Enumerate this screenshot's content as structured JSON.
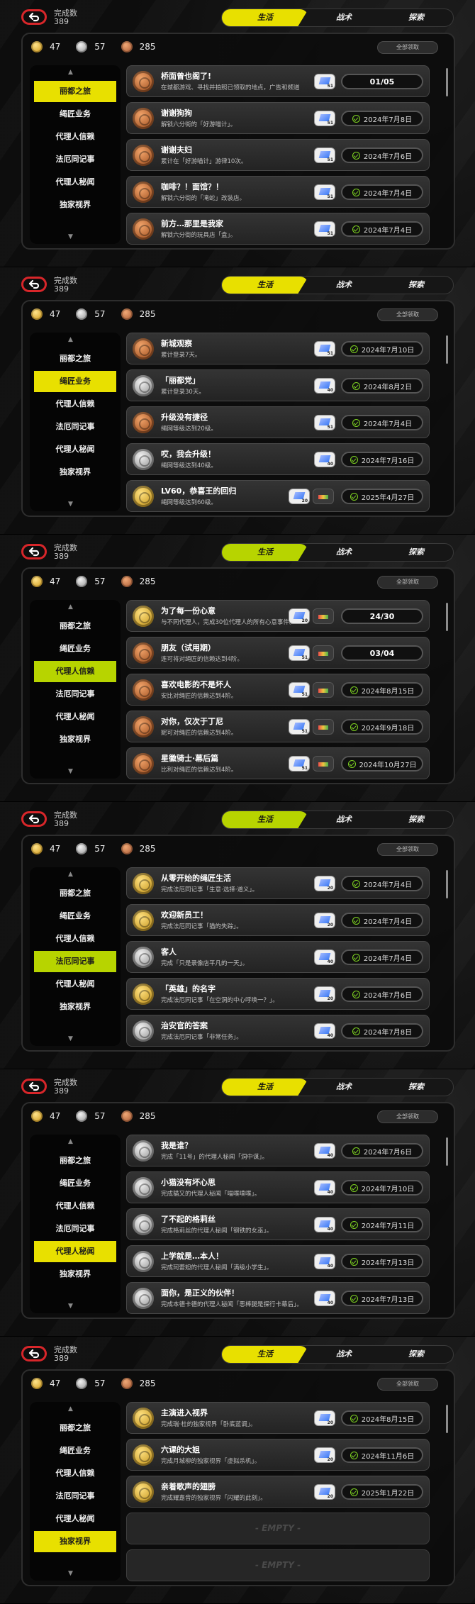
{
  "header": {
    "count_label": "完成数",
    "count_value": "389",
    "tabs": [
      "生活",
      "战术",
      "探索"
    ],
    "claim_all": "全部领取"
  },
  "currency": {
    "gold": "47",
    "silver": "57",
    "bronze": "285"
  },
  "sidebar": [
    "丽都之旅",
    "绳匠业务",
    "代理人信赖",
    "法厄同记事",
    "代理人秘闻",
    "独家视界"
  ],
  "panels": [
    {
      "active_index": 0,
      "items": [
        {
          "title": "桥面曾也阁了!",
          "desc": "在城都游戏、寻找并拍照已领取的地点，广告和频道",
          "medal": "bronze",
          "rewards": [
            {
              "type": "film",
              "n": "51"
            }
          ],
          "status": "01/05",
          "kind": "progress"
        },
        {
          "title": "谢谢狗狗",
          "desc": "解锁六分街的「好游喵计」。",
          "medal": "bronze",
          "rewards": [
            {
              "type": "film",
              "n": "51"
            }
          ],
          "status": "2024年7月8日",
          "kind": "done"
        },
        {
          "title": "谢谢夫妇",
          "desc": "累计在「好游喵计」游律10次。",
          "medal": "bronze",
          "rewards": [
            {
              "type": "film",
              "n": "51"
            }
          ],
          "status": "2024年7月6日",
          "kind": "done"
        },
        {
          "title": "咖啡？！面馆？！",
          "desc": "解锁六分街的「滝蛇」改装店。",
          "medal": "bronze",
          "rewards": [
            {
              "type": "film",
              "n": "51"
            }
          ],
          "status": "2024年7月4日",
          "kind": "done"
        },
        {
          "title": "前方…那里是我家",
          "desc": "解锁六分街的玩具店「盒」。",
          "medal": "bronze",
          "rewards": [
            {
              "type": "film",
              "n": "51"
            }
          ],
          "status": "2024年7月4日",
          "kind": "done"
        }
      ]
    },
    {
      "active_index": 1,
      "items": [
        {
          "title": "新城观察",
          "desc": "累计登录7天。",
          "medal": "bronze",
          "rewards": [
            {
              "type": "film",
              "n": "51"
            }
          ],
          "status": "2024年7月10日",
          "kind": "done"
        },
        {
          "title": "「丽都党」",
          "desc": "累计登录30天。",
          "medal": "silver",
          "rewards": [
            {
              "type": "film",
              "n": "40"
            }
          ],
          "status": "2024年8月2日",
          "kind": "done"
        },
        {
          "title": "升级没有捷径",
          "desc": "绳网等级达到20级。",
          "medal": "bronze",
          "rewards": [
            {
              "type": "film",
              "n": "51"
            }
          ],
          "status": "2024年7月4日",
          "kind": "done"
        },
        {
          "title": "哎，我会升级！",
          "desc": "绳网等级达到40级。",
          "medal": "silver",
          "rewards": [
            {
              "type": "film",
              "n": "40"
            }
          ],
          "status": "2024年7月16日",
          "kind": "done"
        },
        {
          "title": "LV60，恭喜王的回归",
          "desc": "绳网等级达到60级。",
          "medal": "gold",
          "rewards": [
            {
              "type": "film",
              "n": "20"
            },
            {
              "type": "card",
              "n": ""
            }
          ],
          "status": "2025年4月27日",
          "kind": "done"
        }
      ]
    },
    {
      "active_index": 2,
      "items": [
        {
          "title": "为了每一份心意",
          "desc": "与不同代理人，完成30位代理人的所有心意事件。",
          "medal": "gold",
          "rewards": [
            {
              "type": "film",
              "n": "20"
            },
            {
              "type": "card",
              "n": ""
            }
          ],
          "status": "24/30",
          "kind": "progress"
        },
        {
          "title": "朋友（试用期）",
          "desc": "连可将对绳匠的信赖达到4阶。",
          "medal": "bronze",
          "rewards": [
            {
              "type": "film",
              "n": "51"
            },
            {
              "type": "card",
              "n": ""
            }
          ],
          "status": "03/04",
          "kind": "progress"
        },
        {
          "title": "喜欢电影的不是坏人",
          "desc": "安比对绳匠的信赖达到4阶。",
          "medal": "bronze",
          "rewards": [
            {
              "type": "film",
              "n": "51"
            },
            {
              "type": "card",
              "n": ""
            }
          ],
          "status": "2024年8月15日",
          "kind": "done"
        },
        {
          "title": "对你，仅次于丁尼",
          "desc": "妮可对绳匠的信赖达到4阶。",
          "medal": "bronze",
          "rewards": [
            {
              "type": "film",
              "n": "51"
            },
            {
              "type": "card",
              "n": ""
            }
          ],
          "status": "2024年9月18日",
          "kind": "done"
        },
        {
          "title": "星徽骑士·幕后篇",
          "desc": "比利对绳匠的信赖达到4阶。",
          "medal": "bronze",
          "rewards": [
            {
              "type": "film",
              "n": "51"
            },
            {
              "type": "card",
              "n": ""
            }
          ],
          "status": "2024年10月27日",
          "kind": "done"
        }
      ]
    },
    {
      "active_index": 3,
      "items": [
        {
          "title": "从零开始的绳匠生活",
          "desc": "完成法厄同记事「生意·选择·道义」。",
          "medal": "gold",
          "rewards": [
            {
              "type": "film",
              "n": "20"
            }
          ],
          "status": "2024年7月4日",
          "kind": "done"
        },
        {
          "title": "欢迎新员工！",
          "desc": "完成法厄同记事「猫的失踪」。",
          "medal": "gold",
          "rewards": [
            {
              "type": "film",
              "n": "20"
            }
          ],
          "status": "2024年7月4日",
          "kind": "done"
        },
        {
          "title": "客人",
          "desc": "完成「只是录像店平凡的一天」。",
          "medal": "silver",
          "rewards": [
            {
              "type": "film",
              "n": "40"
            }
          ],
          "status": "2024年7月4日",
          "kind": "done"
        },
        {
          "title": "「英雄」的名字",
          "desc": "完成法厄同记事「在空洞的中心呼唤一？」。",
          "medal": "gold",
          "rewards": [
            {
              "type": "film",
              "n": "20"
            }
          ],
          "status": "2024年7月6日",
          "kind": "done"
        },
        {
          "title": "治安官的答案",
          "desc": "完成法厄同记事「非常任务」。",
          "medal": "silver",
          "rewards": [
            {
              "type": "film",
              "n": "40"
            }
          ],
          "status": "2024年7月8日",
          "kind": "done"
        }
      ]
    },
    {
      "active_index": 4,
      "items": [
        {
          "title": "我是谁？",
          "desc": "完成「11号」的代理人秘闻「洞中谋」。",
          "medal": "silver",
          "rewards": [
            {
              "type": "film",
              "n": "40"
            }
          ],
          "status": "2024年7月6日",
          "kind": "done"
        },
        {
          "title": "小猫没有坏心思",
          "desc": "完成猫又的代理人秘闻「喵噗噗噗」。",
          "medal": "silver",
          "rewards": [
            {
              "type": "film",
              "n": "40"
            }
          ],
          "status": "2024年7月10日",
          "kind": "done"
        },
        {
          "title": "了不起的格莉丝",
          "desc": "完成格莉丝的代理人秘闻「钢铁的女巫」。",
          "medal": "silver",
          "rewards": [
            {
              "type": "film",
              "n": "40"
            }
          ],
          "status": "2024年7月11日",
          "kind": "done"
        },
        {
          "title": "上学就是…本人！",
          "desc": "完成珂蕾妲的代理人秘闻「满级小学生」。",
          "medal": "silver",
          "rewards": [
            {
              "type": "film",
              "n": "40"
            }
          ],
          "status": "2024年7月13日",
          "kind": "done"
        },
        {
          "title": "面你，是正义的伙伴！",
          "desc": "完成本德卡德的代理人秘闻「恶棒腿是探行卡幕后」。",
          "medal": "silver",
          "rewards": [
            {
              "type": "film",
              "n": "40"
            }
          ],
          "status": "2024年7月13日",
          "kind": "done"
        }
      ]
    },
    {
      "active_index": 5,
      "items": [
        {
          "title": "主演进入视界",
          "desc": "完成瑞·杜的独家视界「卧底蓝调」。",
          "medal": "gold",
          "rewards": [
            {
              "type": "film",
              "n": "20"
            }
          ],
          "status": "2024年8月15日",
          "kind": "done"
        },
        {
          "title": "六课的大姐",
          "desc": "完成月城柳的独家视界「虚拟杀机」。",
          "medal": "gold",
          "rewards": [
            {
              "type": "film",
              "n": "20"
            }
          ],
          "status": "2024年11月6日",
          "kind": "done"
        },
        {
          "title": "亲着歌声的翅膀",
          "desc": "完成耀嘉音的独家视界「闪耀的此刻」。",
          "medal": "gold",
          "rewards": [
            {
              "type": "film",
              "n": "20"
            }
          ],
          "status": "2025年1月22日",
          "kind": "done"
        }
      ],
      "empty": [
        "- EMPTY -",
        "- EMPTY -"
      ]
    }
  ],
  "colors": {
    "accent_yellow": "#e8e000",
    "accent_lime": "#b7d400",
    "check": "#7ed321"
  }
}
